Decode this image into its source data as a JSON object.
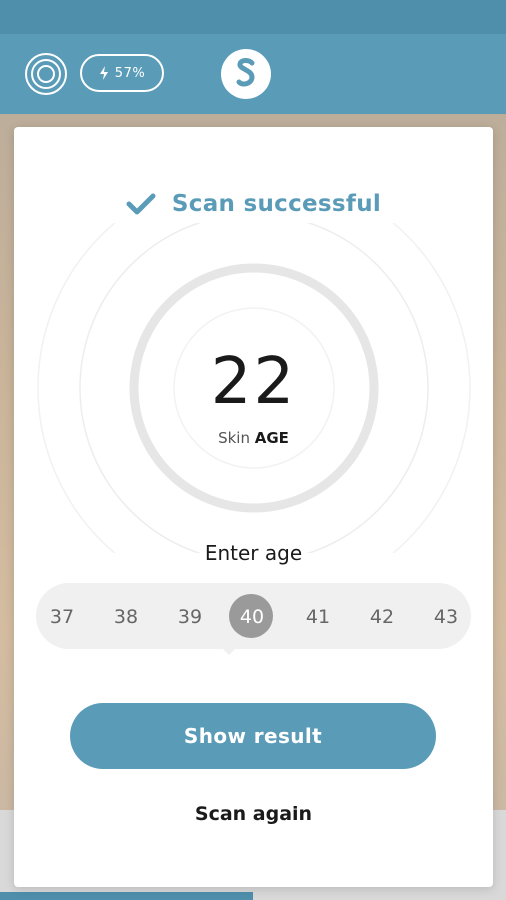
{
  "topbar": {
    "battery_label": "57%"
  },
  "result": {
    "status": "Scan successful",
    "age_value": "22",
    "caption_prefix": "Skin",
    "caption_emphasis": "AGE"
  },
  "picker": {
    "title": "Enter age",
    "values": [
      "37",
      "38",
      "39",
      "40",
      "41",
      "42",
      "43"
    ],
    "selected": "40"
  },
  "actions": {
    "show_result_label": "Show result",
    "scan_again_label": "Scan again"
  },
  "colors": {
    "accent": "#5a9bb8",
    "status_strip": "#4f8fac",
    "selected": "#9a9a9a",
    "picker_bg": "#f0f0f0"
  },
  "icons": [
    "target-icon",
    "bolt-icon",
    "brand-logo-icon",
    "check-icon"
  ]
}
